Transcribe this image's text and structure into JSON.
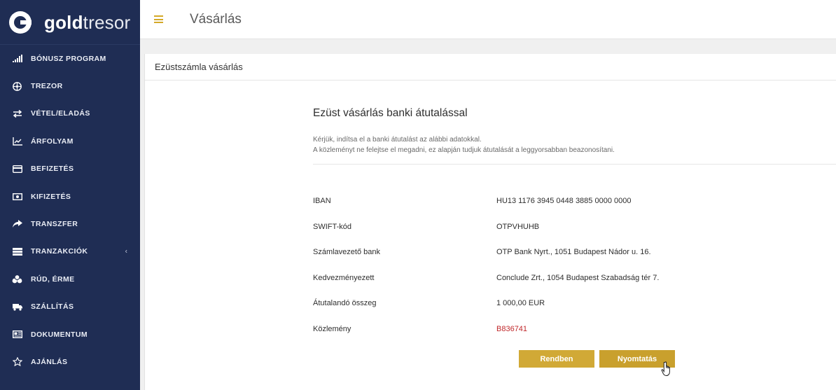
{
  "brand": {
    "bold": "gold",
    "light": "tresor"
  },
  "header": {
    "title": "Vásárlás"
  },
  "sidebar": {
    "items": [
      {
        "label": "BÓNUSZ PROGRAM",
        "icon": "signal-bars-icon"
      },
      {
        "label": "TREZOR",
        "icon": "vault-icon"
      },
      {
        "label": "VÉTEL/ELADÁS",
        "icon": "exchange-icon"
      },
      {
        "label": "ÁRFOLYAM",
        "icon": "chart-line-icon"
      },
      {
        "label": "BEFIZETÉS",
        "icon": "card-icon"
      },
      {
        "label": "KIFIZETÉS",
        "icon": "money-icon"
      },
      {
        "label": "TRANSZFER",
        "icon": "share-arrow-icon"
      },
      {
        "label": "TRANZAKCIÓK",
        "icon": "list-icon",
        "chevron": "‹"
      },
      {
        "label": "RÚD, ÉRME",
        "icon": "coins-icon"
      },
      {
        "label": "SZÁLLÍTÁS",
        "icon": "truck-icon"
      },
      {
        "label": "DOKUMENTUM",
        "icon": "document-icon"
      },
      {
        "label": "AJÁNLÁS",
        "icon": "star-icon"
      }
    ]
  },
  "panel": {
    "heading": "Ezüstszámla vásárlás",
    "section_title": "Ezüst vásárlás banki átutalással",
    "desc_line1": "Kérjük, indítsa el a banki átutalást az alábbi adatokkal.",
    "desc_line2": "A közleményt ne felejtse el megadni, ez alapján tudjuk átutalását a leggyorsabban beazonosítani.",
    "rows": [
      {
        "label": "IBAN",
        "value": "HU13 1176 3945 0448 3885 0000 0000"
      },
      {
        "label": "SWIFT-kód",
        "value": "OTPVHUHB"
      },
      {
        "label": "Számlavezető bank",
        "value": "OTP Bank Nyrt., 1051 Budapest Nádor u. 16."
      },
      {
        "label": "Kedvezményezett",
        "value": "Conclude Zrt., 1054 Budapest Szabadság tér 7."
      },
      {
        "label": "Átutalandó összeg",
        "value": "1 000,00  EUR"
      },
      {
        "label": "Közlemény",
        "value": "B836741"
      }
    ],
    "buttons": {
      "ok": "Rendben",
      "print": "Nyomtatás"
    }
  },
  "colors": {
    "sidebar": "#1f2d54",
    "accent": "#d1a936",
    "reference": "#c0282b"
  }
}
